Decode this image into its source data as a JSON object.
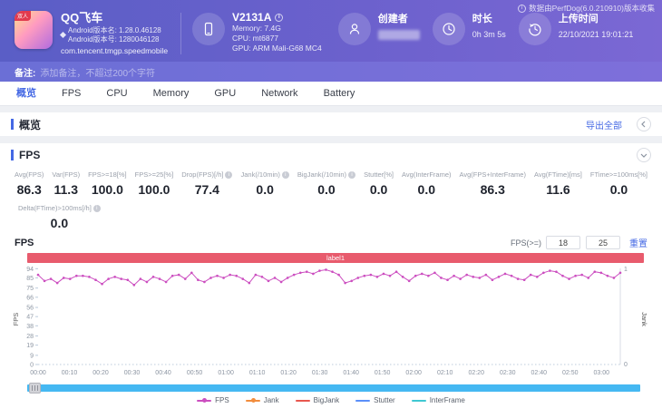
{
  "meta": {
    "collect_note": "数据由PerfDog(6.0.210910)版本收集"
  },
  "header": {
    "app": {
      "name": "QQ飞车",
      "ribbon": "双人",
      "version_name": "Android版本名: 1.28.0.46128",
      "version_code": "Android版本号: 1280046128",
      "package": "com.tencent.tmgp.speedmobile"
    },
    "device": {
      "model": "V2131A",
      "memory": "Memory: 7.4G",
      "cpu": "CPU: mt6877",
      "gpu": "GPU: ARM Mali-G68 MC4"
    },
    "creator": {
      "label": "创建者"
    },
    "duration": {
      "label": "时长",
      "value": "0h 3m 5s"
    },
    "upload": {
      "label": "上传时间",
      "value": "22/10/2021 19:01:21"
    }
  },
  "note": {
    "label": "备注:",
    "placeholder": "添加备注，不超过200个字符"
  },
  "tabs": [
    {
      "label": "概览",
      "active": true
    },
    {
      "label": "FPS",
      "active": false
    },
    {
      "label": "CPU",
      "active": false
    },
    {
      "label": "Memory",
      "active": false
    },
    {
      "label": "GPU",
      "active": false
    },
    {
      "label": "Network",
      "active": false
    },
    {
      "label": "Battery",
      "active": false
    }
  ],
  "overview": {
    "title": "概览",
    "export_label": "导出全部"
  },
  "fps_section": {
    "title": "FPS",
    "chart_title": "FPS",
    "band_label": "label1",
    "threshold": {
      "label": "FPS(>=)",
      "input1": "18",
      "input2": "25",
      "reset_label": "重置"
    },
    "metrics": [
      {
        "label": "Avg(FPS)",
        "value": "86.3",
        "info": false
      },
      {
        "label": "Var(FPS)",
        "value": "11.3",
        "info": false
      },
      {
        "label": "FPS>=18[%]",
        "value": "100.0",
        "info": false
      },
      {
        "label": "FPS>=25[%]",
        "value": "100.0",
        "info": false
      },
      {
        "label": "Drop(FPS)[/h]",
        "value": "77.4",
        "info": true
      },
      {
        "label": "Jank(/10min)",
        "value": "0.0",
        "info": true
      },
      {
        "label": "BigJank(/10min)",
        "value": "0.0",
        "info": true
      },
      {
        "label": "Stutter[%]",
        "value": "0.0",
        "info": false
      },
      {
        "label": "Avg(InterFrame)",
        "value": "0.0",
        "info": false
      },
      {
        "label": "Avg(FPS+InterFrame)",
        "value": "86.3",
        "info": false
      },
      {
        "label": "Avg(FTime)[ms]",
        "value": "11.6",
        "info": false
      },
      {
        "label": "FTime>=100ms[%]",
        "value": "0.0",
        "info": false
      }
    ],
    "metrics_row2": [
      {
        "label": "Delta(FTime)>100ms[/h]",
        "value": "0.0",
        "info": true
      }
    ]
  },
  "chart_data": {
    "type": "line",
    "title": "FPS",
    "ylabel": "FPS",
    "y2label": "Jank",
    "ylim": [
      0,
      94.3
    ],
    "yticks": [
      0,
      9,
      19,
      28,
      38,
      47,
      56,
      66,
      75,
      85,
      94
    ],
    "y2ticks": [
      0,
      1
    ],
    "x_unit": "mm:ss",
    "xticklabels": [
      "00:00",
      "00:10",
      "00:20",
      "00:30",
      "00:40",
      "00:50",
      "01:00",
      "01:10",
      "01:20",
      "01:30",
      "01:40",
      "01:50",
      "02:00",
      "02:10",
      "02:20",
      "02:30",
      "02:40",
      "02:50",
      "03:00"
    ],
    "grid": false,
    "legend_position": "bottom",
    "series": [
      {
        "name": "FPS",
        "color": "#cc4fc0",
        "values": [
          88,
          82,
          84,
          80,
          85,
          84,
          87,
          87,
          86,
          83,
          79,
          84,
          86,
          84,
          83,
          78,
          84,
          81,
          86,
          84,
          81,
          87,
          88,
          84,
          90,
          83,
          81,
          85,
          87,
          85,
          88,
          87,
          84,
          80,
          88,
          86,
          82,
          85,
          81,
          85,
          88,
          90,
          91,
          89,
          92,
          93,
          91,
          88,
          80,
          82,
          85,
          87,
          88,
          86,
          89,
          87,
          91,
          86,
          82,
          87,
          89,
          87,
          90,
          85,
          83,
          87,
          84,
          88,
          86,
          85,
          88,
          83,
          86,
          89,
          87,
          84,
          83,
          88,
          86,
          90,
          92,
          91,
          87,
          84,
          87,
          88,
          85,
          91,
          90,
          87,
          85,
          90
        ]
      },
      {
        "name": "Jank",
        "color": "#f28d3d",
        "constant": 0
      },
      {
        "name": "BigJank",
        "color": "#e8574f",
        "constant": 0
      },
      {
        "name": "Stutter",
        "color": "#5b8ff9",
        "constant": 0
      },
      {
        "name": "InterFrame",
        "color": "#3fc8d2",
        "constant": 0
      }
    ],
    "legend": [
      {
        "name": "FPS",
        "color": "#cc4fc0",
        "marker": true
      },
      {
        "name": "Jank",
        "color": "#f28d3d",
        "marker": true
      },
      {
        "name": "BigJank",
        "color": "#e8574f",
        "marker": false
      },
      {
        "name": "Stutter",
        "color": "#5b8ff9",
        "marker": false
      },
      {
        "name": "InterFrame",
        "color": "#3fc8d2",
        "marker": false
      }
    ]
  }
}
